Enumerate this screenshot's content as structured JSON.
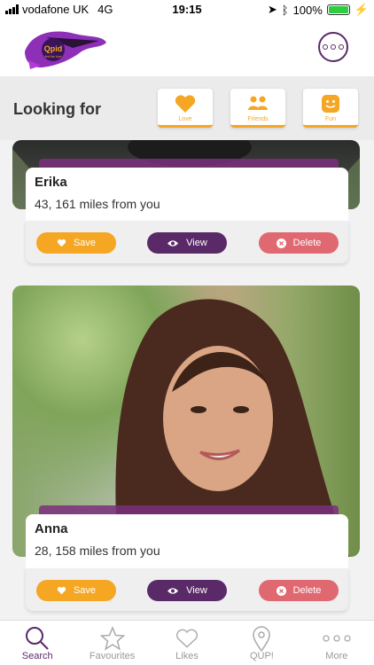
{
  "status_bar": {
    "carrier": "vodafone UK",
    "network": "4G",
    "time": "19:15",
    "battery": "100%",
    "battery_fraction": 1.0
  },
  "header": {
    "logo_text": "Qpid",
    "logo_tagline": "find the love",
    "chat_icon": "chat-bubble-icon"
  },
  "filter": {
    "title": "Looking for",
    "options": [
      {
        "label": "Love",
        "icon": "heart-icon"
      },
      {
        "label": "Friends",
        "icon": "people-icon"
      },
      {
        "label": "Fun",
        "icon": "smiley-icon"
      }
    ]
  },
  "profiles": [
    {
      "name": "Erika",
      "details": "43, 161 miles from you"
    },
    {
      "name": "Anna",
      "details": "28, 158 miles from you"
    }
  ],
  "actions": {
    "save": "Save",
    "view": "View",
    "delete": "Delete"
  },
  "tabs": [
    {
      "label": "Search",
      "icon": "search-icon"
    },
    {
      "label": "Favourites",
      "icon": "star-icon"
    },
    {
      "label": "Likes",
      "icon": "heart-icon"
    },
    {
      "label": "QUP!",
      "icon": "location-pin-icon"
    },
    {
      "label": "More",
      "icon": "ellipsis-icon"
    }
  ],
  "colors": {
    "accent": "#f5a623",
    "brand": "#5a2a68",
    "delete": "#e06870"
  }
}
